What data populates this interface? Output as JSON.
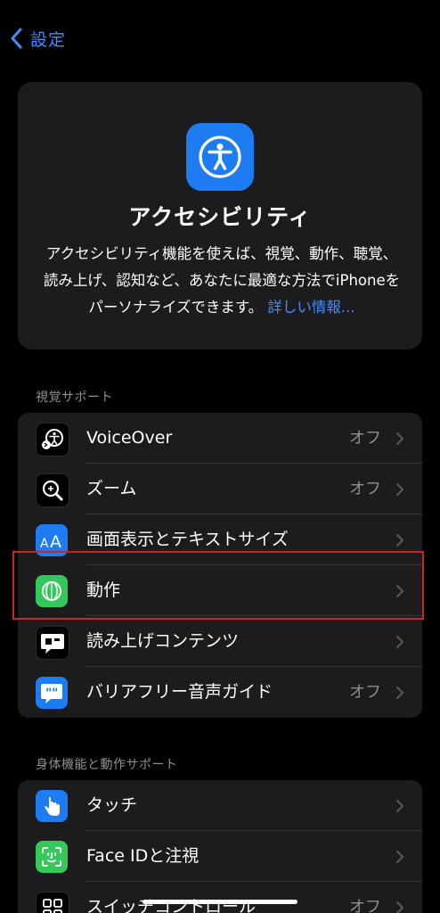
{
  "nav": {
    "back_label": "設定"
  },
  "hero": {
    "title": "アクセシビリティ",
    "description": "アクセシビリティ機能を使えば、視覚、動作、聴覚、読み上げ、認知など、あなたに最適な方法でiPhoneをパーソナライズできます。",
    "link": "詳しい情報..."
  },
  "sections": {
    "vision": {
      "header": "視覚サポート",
      "items": [
        {
          "label": "VoiceOver",
          "value": "オフ",
          "icon": "voiceover-icon"
        },
        {
          "label": "ズーム",
          "value": "オフ",
          "icon": "zoom-icon"
        },
        {
          "label": "画面表示とテキストサイズ",
          "value": "",
          "icon": "display-text-size-icon"
        },
        {
          "label": "動作",
          "value": "",
          "icon": "motion-icon"
        },
        {
          "label": "読み上げコンテンツ",
          "value": "",
          "icon": "spoken-content-icon"
        },
        {
          "label": "バリアフリー音声ガイド",
          "value": "オフ",
          "icon": "audio-descriptions-icon"
        }
      ]
    },
    "physical": {
      "header": "身体機能と動作サポート",
      "items": [
        {
          "label": "タッチ",
          "value": "",
          "icon": "touch-icon"
        },
        {
          "label": "Face IDと注視",
          "value": "",
          "icon": "face-id-icon"
        },
        {
          "label": "スイッチコントロール",
          "value": "オフ",
          "icon": "switch-control-icon"
        }
      ]
    }
  },
  "colors": {
    "accent": "#3d8dff",
    "background": "#000000",
    "cell": "#1c1c1e",
    "highlight": "#c62828"
  }
}
